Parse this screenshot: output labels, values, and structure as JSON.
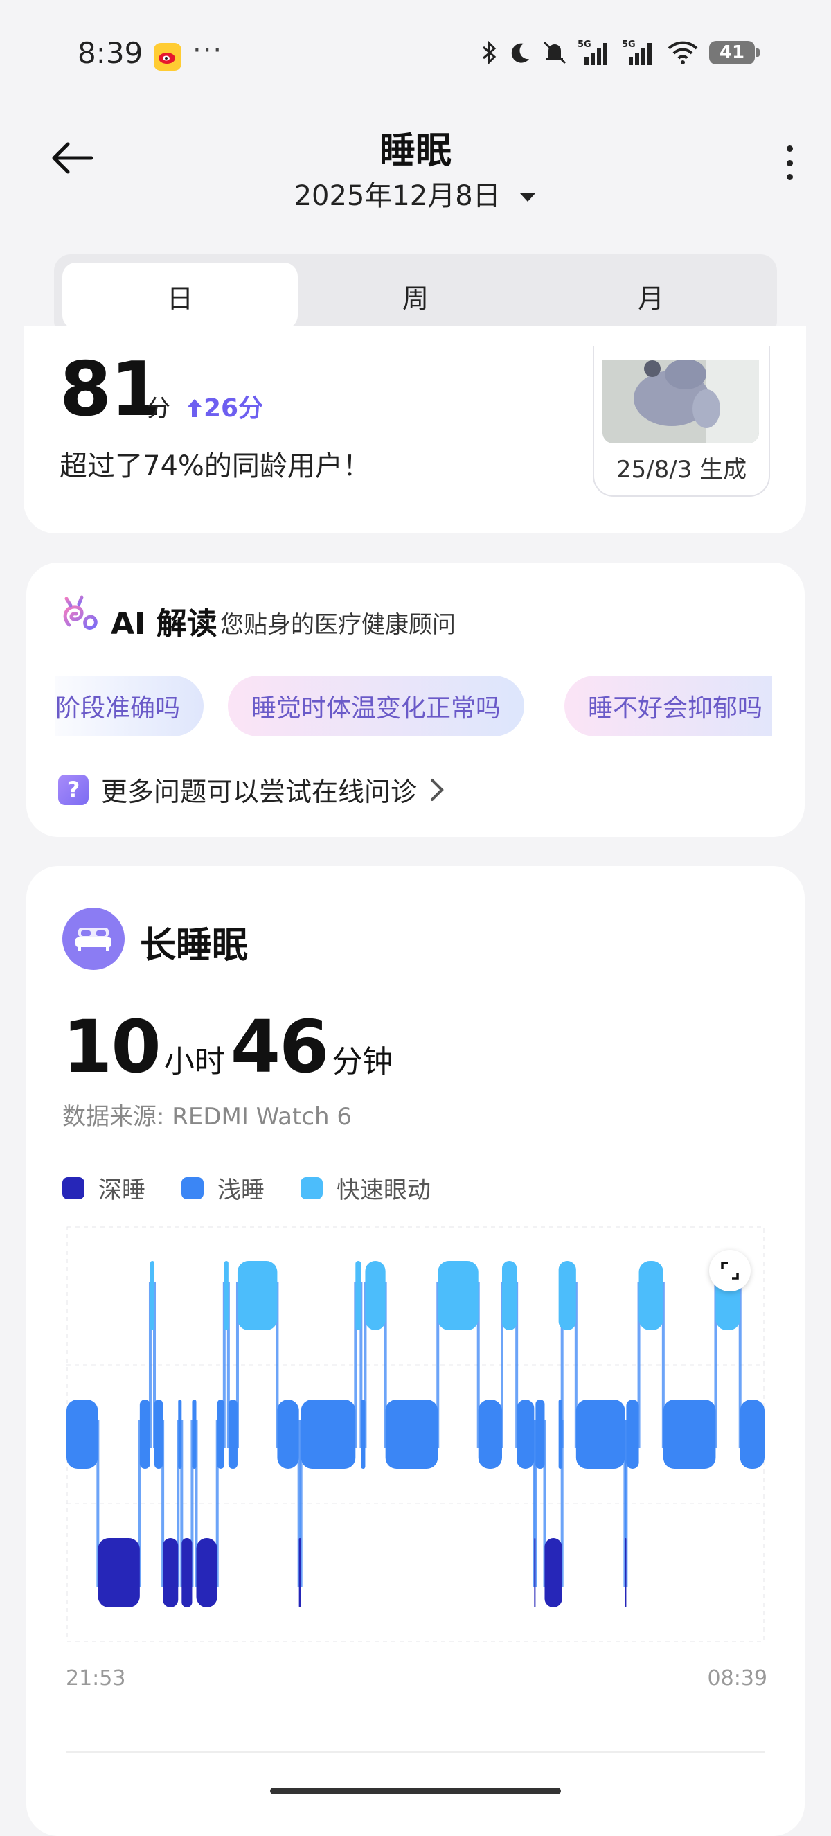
{
  "status_bar": {
    "time": "8:39",
    "dots": "···",
    "battery": "41"
  },
  "header": {
    "title": "睡眠",
    "date": "2025年12月8日"
  },
  "tabs": [
    {
      "label": "日",
      "active": true
    },
    {
      "label": "周"
    },
    {
      "label": "月"
    }
  ],
  "score": {
    "value": "81",
    "unit": "分",
    "delta": "26分",
    "desc": "超过了74%的同龄用户！",
    "thumbnail_caption": "25/8/3 生成"
  },
  "ai": {
    "title": "AI 解读",
    "subtitle": "您贴身的医疗健康顾问",
    "chips": [
      "阶段准确吗",
      "睡觉时体温变化正常吗",
      "睡不好会抑郁吗"
    ],
    "more_questions": "更多问题可以尝试在线问诊"
  },
  "sleep": {
    "section_title": "长睡眠",
    "hours": "10",
    "hours_unit": "小时",
    "minutes": "46",
    "minutes_unit": "分钟",
    "data_source": "数据来源: REDMI Watch 6",
    "legend": [
      {
        "label": "深睡",
        "color": "#2626b8"
      },
      {
        "label": "浅睡",
        "color": "#3b86f5"
      },
      {
        "label": "快速眼动",
        "color": "#4cbdfb"
      }
    ],
    "start_time": "21:53",
    "end_time": "08:39"
  },
  "chart_data": {
    "type": "timeline",
    "levels": [
      "快速眼动",
      "浅睡",
      "深睡"
    ],
    "segments": [
      {
        "stage": "浅睡",
        "start": 0.0,
        "end": 0.045
      },
      {
        "stage": "深睡",
        "start": 0.045,
        "end": 0.105
      },
      {
        "stage": "浅睡",
        "start": 0.105,
        "end": 0.12
      },
      {
        "stage": "快速眼动",
        "start": 0.12,
        "end": 0.126
      },
      {
        "stage": "浅睡",
        "start": 0.126,
        "end": 0.138
      },
      {
        "stage": "深睡",
        "start": 0.138,
        "end": 0.16
      },
      {
        "stage": "浅睡",
        "start": 0.16,
        "end": 0.165
      },
      {
        "stage": "深睡",
        "start": 0.165,
        "end": 0.18
      },
      {
        "stage": "浅睡",
        "start": 0.18,
        "end": 0.186
      },
      {
        "stage": "深睡",
        "start": 0.186,
        "end": 0.216
      },
      {
        "stage": "浅睡",
        "start": 0.216,
        "end": 0.226
      },
      {
        "stage": "快速眼动",
        "start": 0.226,
        "end": 0.232
      },
      {
        "stage": "浅睡",
        "start": 0.232,
        "end": 0.245
      },
      {
        "stage": "快速眼动",
        "start": 0.245,
        "end": 0.302
      },
      {
        "stage": "浅睡",
        "start": 0.302,
        "end": 0.333
      },
      {
        "stage": "深睡",
        "start": 0.333,
        "end": 0.336
      },
      {
        "stage": "浅睡",
        "start": 0.336,
        "end": 0.414
      },
      {
        "stage": "快速眼动",
        "start": 0.414,
        "end": 0.422
      },
      {
        "stage": "浅睡",
        "start": 0.422,
        "end": 0.428
      },
      {
        "stage": "快速眼动",
        "start": 0.428,
        "end": 0.457
      },
      {
        "stage": "浅睡",
        "start": 0.457,
        "end": 0.532
      },
      {
        "stage": "快速眼动",
        "start": 0.532,
        "end": 0.59
      },
      {
        "stage": "浅睡",
        "start": 0.59,
        "end": 0.624
      },
      {
        "stage": "快速眼动",
        "start": 0.624,
        "end": 0.645
      },
      {
        "stage": "浅睡",
        "start": 0.645,
        "end": 0.67
      },
      {
        "stage": "深睡",
        "start": 0.67,
        "end": 0.672
      },
      {
        "stage": "浅睡",
        "start": 0.672,
        "end": 0.654
      },
      {
        "stage": "浅睡",
        "start": 0.672,
        "end": 0.67
      },
      {
        "stage": "浅睡",
        "start": 0.672,
        "end": 0.685
      },
      {
        "stage": "深睡",
        "start": 0.685,
        "end": 0.71
      },
      {
        "stage": "浅睡",
        "start": 0.71,
        "end": 0.705
      },
      {
        "stage": "浅睡",
        "start": 0.705,
        "end": 0.71
      },
      {
        "stage": "浅睡",
        "start": 0.71,
        "end": 0.71
      },
      {
        "stage": "浅睡",
        "start": 0.71,
        "end": 0.705
      },
      {
        "stage": "快速眼动",
        "start": 0.705,
        "end": 0.73
      },
      {
        "stage": "浅睡",
        "start": 0.73,
        "end": 0.8
      },
      {
        "stage": "深睡",
        "start": 0.8,
        "end": 0.802
      },
      {
        "stage": "浅睡",
        "start": 0.802,
        "end": 0.82
      },
      {
        "stage": "快速眼动",
        "start": 0.82,
        "end": 0.855
      },
      {
        "stage": "浅睡",
        "start": 0.855,
        "end": 0.93
      },
      {
        "stage": "快速眼动",
        "start": 0.93,
        "end": 0.965
      },
      {
        "stage": "浅睡",
        "start": 0.965,
        "end": 1.0
      }
    ]
  }
}
